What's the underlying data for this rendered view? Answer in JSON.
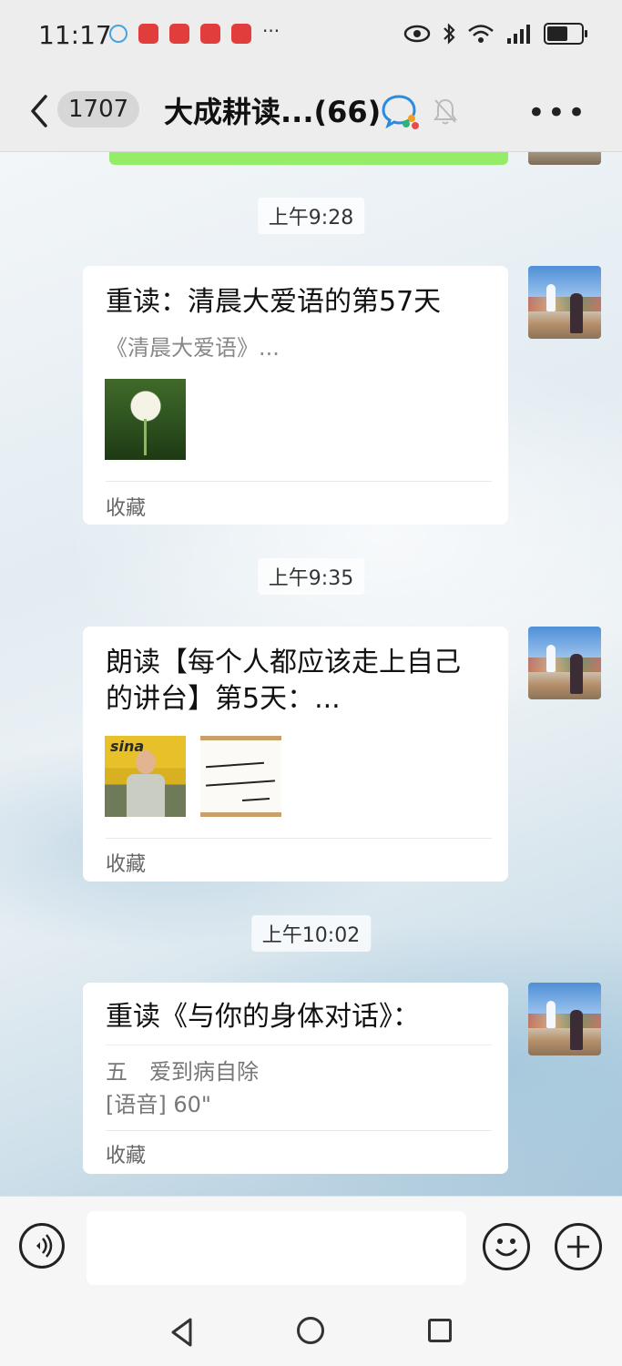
{
  "status_bar": {
    "time": "11:17",
    "notif_dots": "···",
    "battery_level": 0.65
  },
  "header": {
    "unread_count": "1707",
    "title": "大成耕读...(66)"
  },
  "messages": [
    {
      "timestamp": "上午9:28",
      "title": "重读：清晨大爱语的第57天",
      "subtitle": "《清晨大爱语》...",
      "favorite": "收藏",
      "thumbnails": [
        "lotus-image"
      ]
    },
    {
      "timestamp": "上午9:35",
      "title": "朗读【每个人都应该走上自己的讲台】第5天：...",
      "favorite": "收藏",
      "thumbnail_caption": "sina",
      "thumbnails": [
        "speaker-image",
        "calligraphy-image"
      ]
    },
    {
      "timestamp": "上午10:02",
      "title": "重读《与你的身体对话》：",
      "line1": "五　爱到病自除",
      "line2": "[语音] 60\"",
      "favorite": "收藏"
    }
  ],
  "input_bar": {
    "placeholder": ""
  },
  "colors": {
    "sent_bubble": "#95ec69",
    "bubble": "#ffffff",
    "bar": "#ededed"
  }
}
